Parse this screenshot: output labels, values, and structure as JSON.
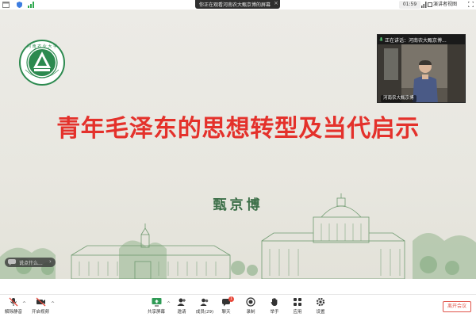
{
  "topbar": {
    "banner_text": "你正在观看河南农大甄京博的屏幕",
    "banner_close": "×",
    "clock": "01:59",
    "view_button": "演讲者视图"
  },
  "slide": {
    "title": "青年毛泽东的思想转型及当代启示",
    "author": "甄京博"
  },
  "video": {
    "speaking_label": "正在讲话：河南农大甄京博...",
    "name_label": "河南农大甄京博"
  },
  "chat": {
    "text": "说点什么..."
  },
  "toolbar": {
    "items": [
      {
        "label": "解除静音",
        "icon": "mic-muted-icon"
      },
      {
        "label": "开启视频",
        "icon": "video-off-icon"
      },
      {
        "label": "共享屏幕",
        "icon": "share-screen-icon"
      },
      {
        "label": "邀请",
        "icon": "invite-icon"
      },
      {
        "label": "成员(29)",
        "icon": "members-icon"
      },
      {
        "label": "聊天",
        "icon": "chat-icon"
      },
      {
        "label": "录制",
        "icon": "record-icon"
      },
      {
        "label": "举手",
        "icon": "raise-hand-icon"
      },
      {
        "label": "应用",
        "icon": "apps-icon"
      },
      {
        "label": "设置",
        "icon": "settings-icon"
      }
    ],
    "chat_badge": "1",
    "leave_button": "离开会议"
  },
  "colors": {
    "title_red": "#e4312b",
    "author_green": "#3c6f48",
    "leave_red": "#e0544a",
    "slide_bg": "#ecebe6"
  }
}
